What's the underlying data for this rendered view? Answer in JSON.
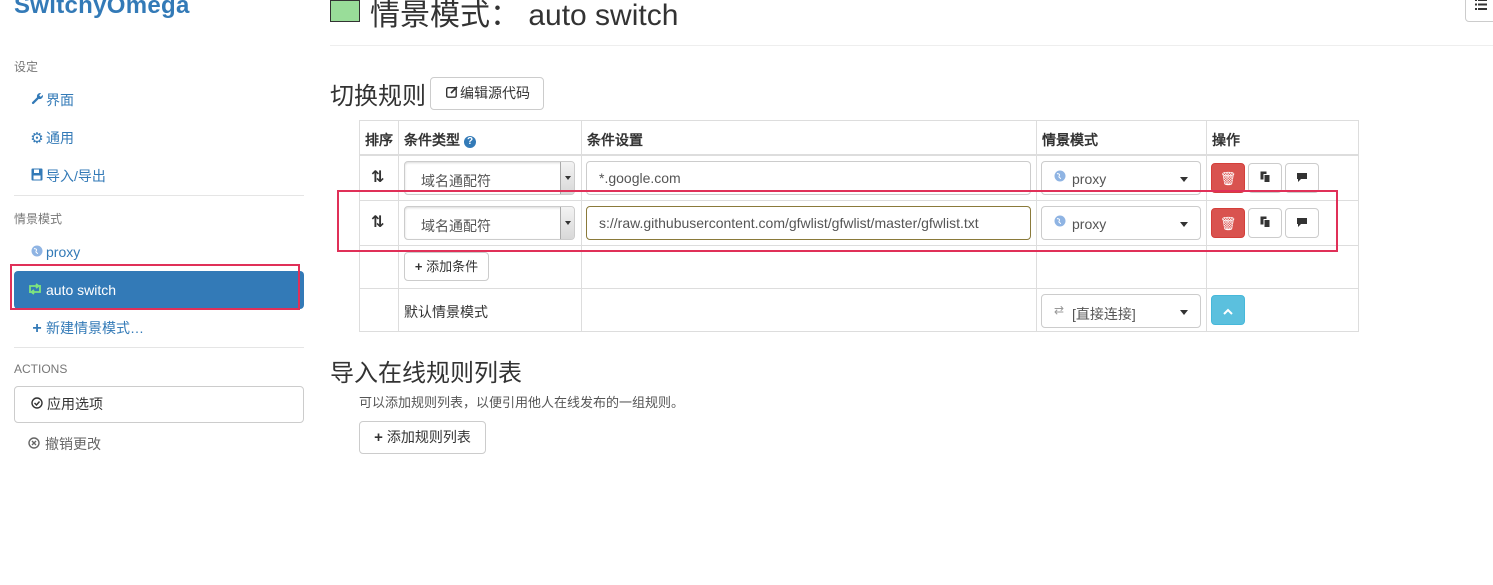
{
  "sidebar": {
    "brand": "SwitchyOmega",
    "settings_header": "设定",
    "settings_items": [
      {
        "label": "界面",
        "icon": "wrench-icon",
        "glyph": "🔧"
      },
      {
        "label": "通用",
        "icon": "gear-icon",
        "glyph": "⚙"
      },
      {
        "label": "导入/导出",
        "icon": "floppy-icon",
        "glyph": "💾"
      }
    ],
    "profiles_header": "情景模式",
    "profiles": [
      {
        "label": "proxy",
        "icon": "globe-icon",
        "glyph": "●"
      },
      {
        "label": "auto switch",
        "icon": "retweet-icon",
        "glyph": "⟲",
        "active": true
      }
    ],
    "new_profile": "新建情景模式…",
    "actions_header": "ACTIONS",
    "apply_label": "应用选项",
    "discard_label": "撤销更改"
  },
  "header": {
    "title": "情景模式： auto switch",
    "swatch_color": "#99dd99"
  },
  "rules": {
    "title": "切换规则",
    "edit_source_label": "编辑源代码",
    "columns": {
      "sort": "排序",
      "condition_type": "条件类型",
      "condition": "条件设置",
      "profile": "情景模式",
      "actions": "操作"
    },
    "rows": [
      {
        "type": "域名通配符",
        "pattern": "*.google.com",
        "profile": "proxy"
      },
      {
        "type": "域名通配符",
        "pattern": "s://raw.githubusercontent.com/gfwlist/gfwlist/master/gfwlist.txt",
        "profile": "proxy"
      }
    ],
    "add_condition_label": "添加条件",
    "default_label": "默认情景模式",
    "default_profile": "[直接连接]"
  },
  "rule_list": {
    "title": "导入在线规则列表",
    "description": "可以添加规则列表，以便引用他人在线发布的一组规则。",
    "add_label": "添加规则列表"
  },
  "colors": {
    "accent": "#337ab7",
    "danger": "#d9534f",
    "info": "#5bc0de",
    "highlight": "#e03058"
  }
}
